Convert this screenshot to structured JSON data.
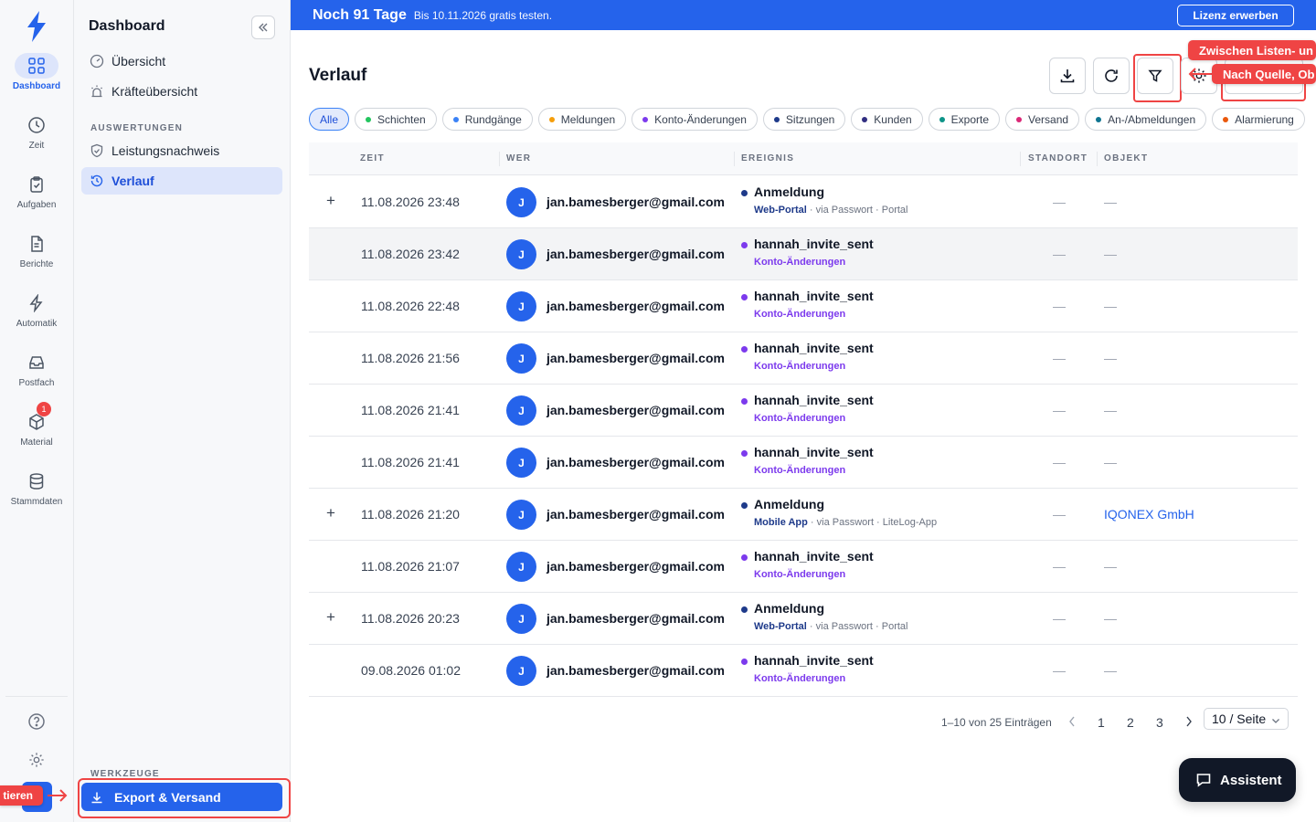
{
  "rail": {
    "items": [
      {
        "label": "Dashboard",
        "icon": "dashboard-grid-icon"
      },
      {
        "label": "Zeit",
        "icon": "clock-icon"
      },
      {
        "label": "Aufgaben",
        "icon": "clipboard-icon"
      },
      {
        "label": "Berichte",
        "icon": "document-icon"
      },
      {
        "label": "Automatik",
        "icon": "lightning-icon"
      },
      {
        "label": "Postfach",
        "icon": "inbox-icon"
      },
      {
        "label": "Material",
        "icon": "package-icon",
        "badge": "1"
      },
      {
        "label": "Stammdaten",
        "icon": "database-icon"
      }
    ],
    "hint_label": "tieren"
  },
  "sidebar": {
    "title": "Dashboard",
    "items": [
      {
        "label": "Übersicht",
        "icon": "gauge-icon"
      },
      {
        "label": "Kräfteübersicht",
        "icon": "siren-icon"
      }
    ],
    "section_auswertungen": "AUSWERTUNGEN",
    "auswertungen_items": [
      {
        "label": "Leistungsnachweis",
        "icon": "shield-check-icon"
      },
      {
        "label": "Verlauf",
        "icon": "history-icon"
      }
    ],
    "section_werkzeuge": "WERKZEUGE",
    "export_label": "Export & Versand"
  },
  "banner": {
    "title": "Noch 91 Tage",
    "subtitle": "Bis 10.11.2026 gratis testen.",
    "button": "Lizenz erwerben"
  },
  "main": {
    "title": "Verlauf",
    "hints": [
      "Zwischen Listen- un",
      "Nach Quelle, Ob"
    ],
    "chips": [
      {
        "label": "Alle",
        "color": ""
      },
      {
        "label": "Schichten",
        "color": "#22c55e"
      },
      {
        "label": "Rundgänge",
        "color": "#3b82f6"
      },
      {
        "label": "Meldungen",
        "color": "#f59e0b"
      },
      {
        "label": "Konto-Änderungen",
        "color": "#7c3aed"
      },
      {
        "label": "Sitzungen",
        "color": "#1e3a8a"
      },
      {
        "label": "Kunden",
        "color": "#312e81"
      },
      {
        "label": "Exporte",
        "color": "#0d9488"
      },
      {
        "label": "Versand",
        "color": "#db2777"
      },
      {
        "label": "An-/Abmeldungen",
        "color": "#0e7490"
      },
      {
        "label": "Alarmierung",
        "color": "#ea580c"
      }
    ],
    "columns": {
      "zeit": "ZEIT",
      "wer": "WER",
      "ereignis": "EREIGNIS",
      "standort": "STANDORT",
      "objekt": "OBJEKT"
    },
    "rows": [
      {
        "expand": "+",
        "time": "11.08.2026 23:48",
        "avatar": "J",
        "user": "jan.bamesberger@gmail.com",
        "event": "Anmeldung",
        "dot": "#1e3a8a",
        "source": "Web-Portal",
        "source_color": "#1e3a8a",
        "meta": " · via Passwort · Portal",
        "standort": "—",
        "objekt": "—"
      },
      {
        "expand": "",
        "time": "11.08.2026 23:42",
        "avatar": "J",
        "user": "jan.bamesberger@gmail.com",
        "event": "hannah_invite_sent",
        "dot": "#7c3aed",
        "source": "Konto-Änderungen",
        "source_color": "#7c3aed",
        "meta": "",
        "standort": "—",
        "objekt": "—"
      },
      {
        "expand": "",
        "time": "11.08.2026 22:48",
        "avatar": "J",
        "user": "jan.bamesberger@gmail.com",
        "event": "hannah_invite_sent",
        "dot": "#7c3aed",
        "source": "Konto-Änderungen",
        "source_color": "#7c3aed",
        "meta": "",
        "standort": "—",
        "objekt": "—"
      },
      {
        "expand": "",
        "time": "11.08.2026 21:56",
        "avatar": "J",
        "user": "jan.bamesberger@gmail.com",
        "event": "hannah_invite_sent",
        "dot": "#7c3aed",
        "source": "Konto-Änderungen",
        "source_color": "#7c3aed",
        "meta": "",
        "standort": "—",
        "objekt": "—"
      },
      {
        "expand": "",
        "time": "11.08.2026 21:41",
        "avatar": "J",
        "user": "jan.bamesberger@gmail.com",
        "event": "hannah_invite_sent",
        "dot": "#7c3aed",
        "source": "Konto-Änderungen",
        "source_color": "#7c3aed",
        "meta": "",
        "standort": "—",
        "objekt": "—"
      },
      {
        "expand": "",
        "time": "11.08.2026 21:41",
        "avatar": "J",
        "user": "jan.bamesberger@gmail.com",
        "event": "hannah_invite_sent",
        "dot": "#7c3aed",
        "source": "Konto-Änderungen",
        "source_color": "#7c3aed",
        "meta": "",
        "standort": "—",
        "objekt": "—"
      },
      {
        "expand": "+",
        "time": "11.08.2026 21:20",
        "avatar": "J",
        "user": "jan.bamesberger@gmail.com",
        "event": "Anmeldung",
        "dot": "#1e3a8a",
        "source": "Mobile App",
        "source_color": "#1e3a8a",
        "meta": " · via Passwort · LiteLog-App",
        "standort": "—",
        "objekt": "IQONEX GmbH"
      },
      {
        "expand": "",
        "time": "11.08.2026 21:07",
        "avatar": "J",
        "user": "jan.bamesberger@gmail.com",
        "event": "hannah_invite_sent",
        "dot": "#7c3aed",
        "source": "Konto-Änderungen",
        "source_color": "#7c3aed",
        "meta": "",
        "standort": "—",
        "objekt": "—"
      },
      {
        "expand": "+",
        "time": "11.08.2026 20:23",
        "avatar": "J",
        "user": "jan.bamesberger@gmail.com",
        "event": "Anmeldung",
        "dot": "#1e3a8a",
        "source": "Web-Portal",
        "source_color": "#1e3a8a",
        "meta": " · via Passwort · Portal",
        "standort": "—",
        "objekt": "—"
      },
      {
        "expand": "",
        "time": "09.08.2026 01:02",
        "avatar": "J",
        "user": "jan.bamesberger@gmail.com",
        "event": "hannah_invite_sent",
        "dot": "#7c3aed",
        "source": "Konto-Änderungen",
        "source_color": "#7c3aed",
        "meta": "",
        "standort": "—",
        "objekt": "—"
      }
    ],
    "highlight_row": 1,
    "pagination": {
      "info": "1–10 von 25 Einträgen",
      "pages": [
        "1",
        "2",
        "3"
      ],
      "per_page": "10 / Seite"
    },
    "assistant_label": "Assistent"
  }
}
